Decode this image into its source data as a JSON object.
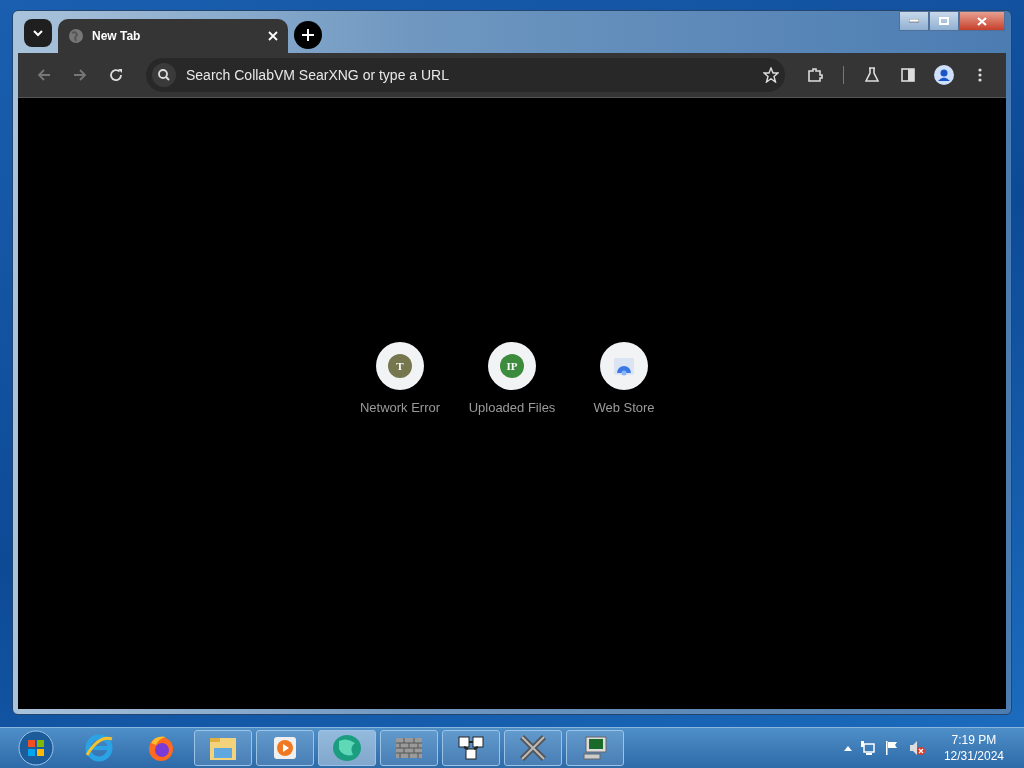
{
  "tabs": [
    {
      "title": "New Tab",
      "selected": true
    }
  ],
  "toolbar": {
    "back": {
      "disabled": true
    },
    "forward": {
      "disabled": true
    }
  },
  "address_bar": {
    "placeholder": "Search CollabVM SearXNG or type a URL"
  },
  "shortcuts": [
    {
      "kind": "letter",
      "letter": "T",
      "color": "#77774f",
      "label": "Network Error"
    },
    {
      "kind": "letter",
      "letter": "IP",
      "color": "#3d8b3d",
      "label": "Uploaded Files"
    },
    {
      "kind": "store",
      "label": "Web Store"
    }
  ],
  "taskbar": {
    "items": [
      {
        "kind": "ie",
        "running": false,
        "selected": false
      },
      {
        "kind": "firefox",
        "running": false,
        "selected": false
      },
      {
        "kind": "folder",
        "running": true,
        "selected": false
      },
      {
        "kind": "media",
        "running": true,
        "selected": false
      },
      {
        "kind": "globe",
        "running": true,
        "selected": true
      },
      {
        "kind": "wall",
        "running": true,
        "selected": false
      },
      {
        "kind": "cubes",
        "running": true,
        "selected": false
      },
      {
        "kind": "cross",
        "running": true,
        "selected": false
      },
      {
        "kind": "monitor",
        "running": true,
        "selected": false
      }
    ]
  },
  "clock": {
    "time": "7:19 PM",
    "date": "12/31/2024"
  }
}
